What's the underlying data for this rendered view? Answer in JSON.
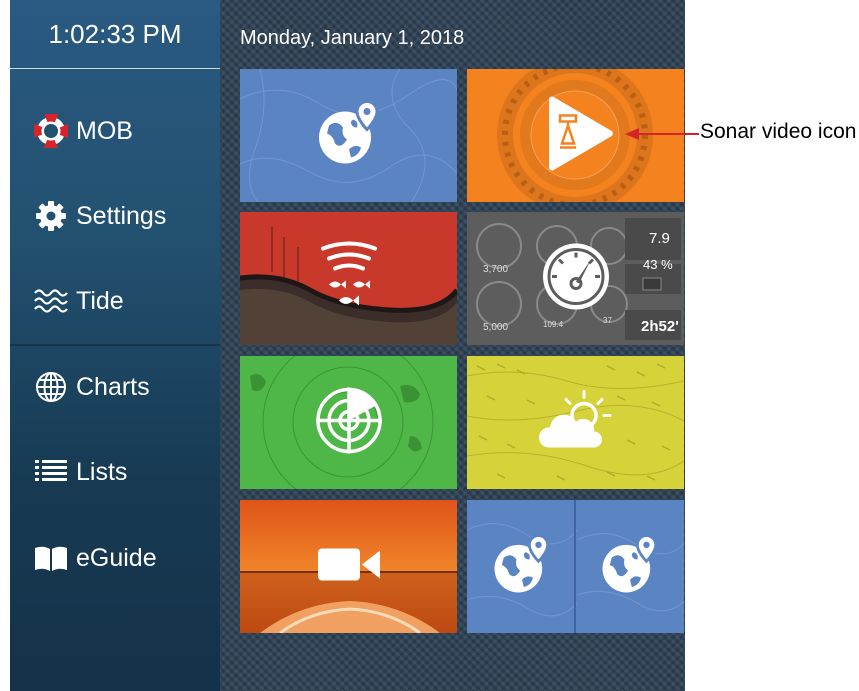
{
  "clock": "1:02:33 PM",
  "date": "Monday, January 1, 2018",
  "sidebar": {
    "items": [
      {
        "label": "MOB",
        "icon": "lifebuoy-icon"
      },
      {
        "label": "Settings",
        "icon": "gear-icon"
      },
      {
        "label": "Tide",
        "icon": "waves-icon"
      },
      {
        "label": "Charts",
        "icon": "globe-icon"
      },
      {
        "label": "Lists",
        "icon": "list-icon"
      },
      {
        "label": "eGuide",
        "icon": "book-icon"
      }
    ]
  },
  "tiles": [
    {
      "name": "chart",
      "icon": "earth-pin-icon",
      "color": "#5b84c3"
    },
    {
      "name": "sonar-video",
      "icon": "sonar-play-icon",
      "color": "#f3821f"
    },
    {
      "name": "fish-finder",
      "icon": "fish-finder-icon",
      "color": "#c8392b"
    },
    {
      "name": "instruments",
      "icon": "gauge-icon",
      "color": "#5d5d5d"
    },
    {
      "name": "radar",
      "icon": "radar-icon",
      "color": "#4fb748"
    },
    {
      "name": "weather",
      "icon": "weather-icon",
      "color": "#d6d23a"
    },
    {
      "name": "camera",
      "icon": "video-camera-icon",
      "color": "#e5641a"
    },
    {
      "name": "dual-chart",
      "icon": "earth-pin-icon",
      "color": "#5b84c3"
    }
  ],
  "instruments": {
    "values": [
      "3,700",
      "5,000",
      "109.4",
      "37",
      "7.9",
      "43 %",
      "2h52'"
    ]
  },
  "callout": {
    "text": "Sonar video icon",
    "arrow_color": "#d9232a"
  },
  "colors": {
    "sidebar": "#22506f",
    "background": "#2b3f52"
  }
}
